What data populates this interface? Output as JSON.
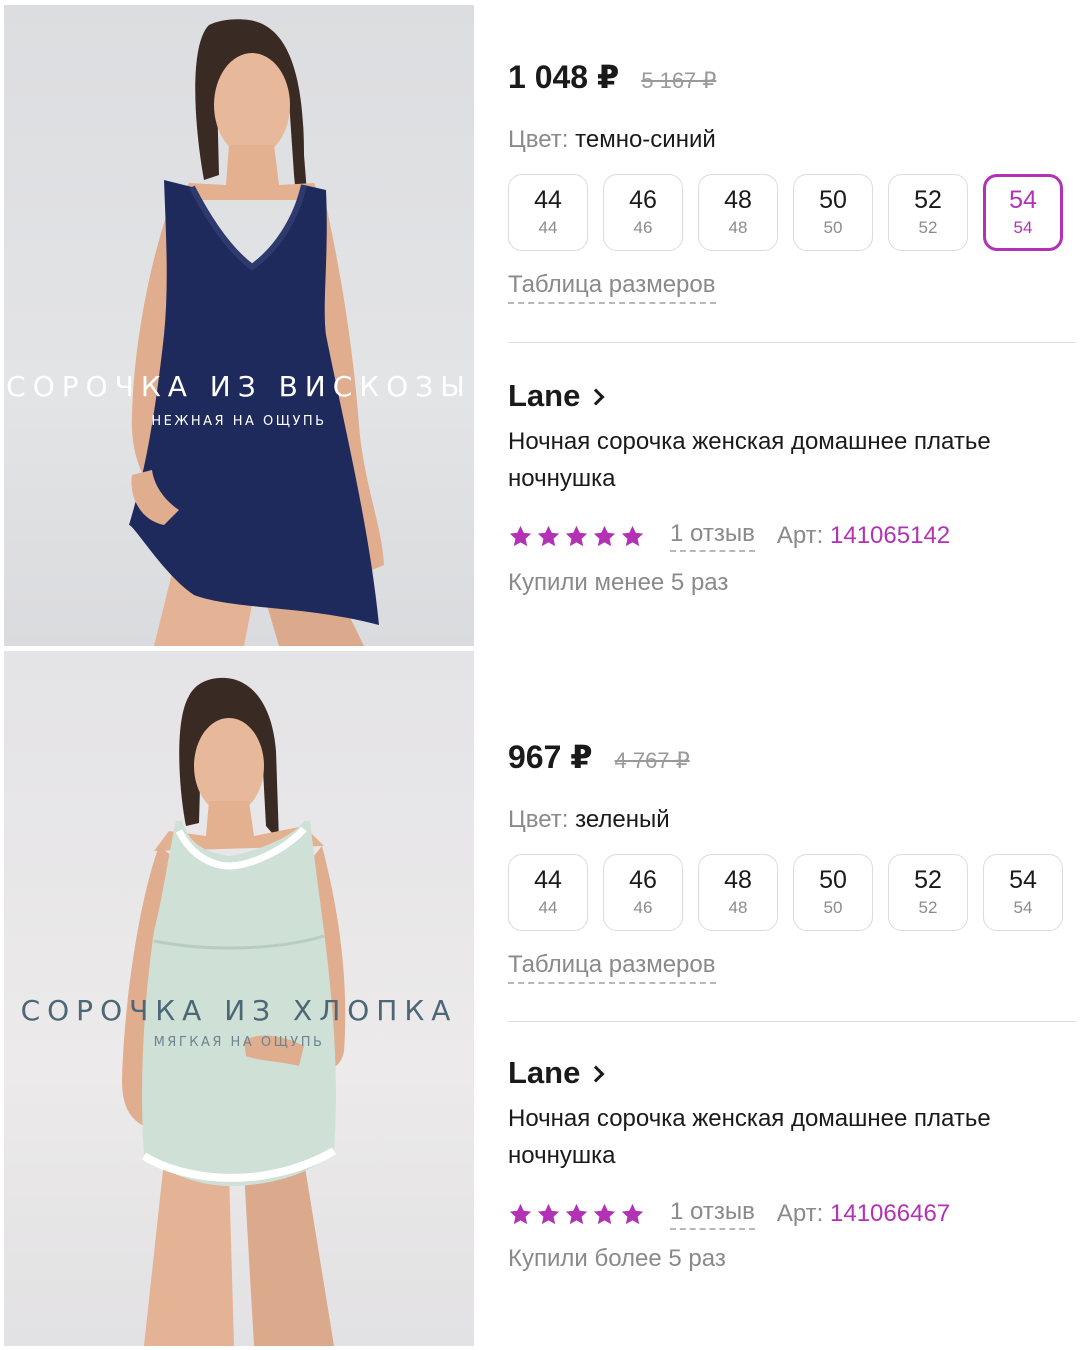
{
  "products": [
    {
      "image": {
        "overlay_title": "СОРОЧКА ИЗ ВИСКОЗЫ",
        "overlay_subtitle": "НЕЖНАЯ НА ОЩУПЬ",
        "garment_color": "#1f2a5c"
      },
      "price": "1 048 ₽",
      "old_price": "5 167 ₽",
      "color_label": "Цвет:",
      "color_value": "темно-синий",
      "sizes": [
        {
          "main": "44",
          "sub": "44",
          "selected": false
        },
        {
          "main": "46",
          "sub": "46",
          "selected": false
        },
        {
          "main": "48",
          "sub": "48",
          "selected": false
        },
        {
          "main": "50",
          "sub": "50",
          "selected": false
        },
        {
          "main": "52",
          "sub": "52",
          "selected": false
        },
        {
          "main": "54",
          "sub": "54",
          "selected": true
        }
      ],
      "size_table_link": "Таблица размеров",
      "brand": "Lane",
      "title": "Ночная сорочка женская домашнее платье ночнушка",
      "rating_stars": 5,
      "reviews": "1 отзыв",
      "art_label": "Арт:",
      "art_number": "141065142",
      "bought": "Купили менее 5 раз"
    },
    {
      "image": {
        "overlay_title": "СОРОЧКА ИЗ ХЛОПКА",
        "overlay_subtitle": "МЯГКАЯ НА ОЩУПЬ",
        "garment_color": "#cfe0d6"
      },
      "price": "967 ₽",
      "old_price": "4 767 ₽",
      "color_label": "Цвет:",
      "color_value": "зеленый",
      "sizes": [
        {
          "main": "44",
          "sub": "44",
          "selected": false
        },
        {
          "main": "46",
          "sub": "46",
          "selected": false
        },
        {
          "main": "48",
          "sub": "48",
          "selected": false
        },
        {
          "main": "50",
          "sub": "50",
          "selected": false
        },
        {
          "main": "52",
          "sub": "52",
          "selected": false
        },
        {
          "main": "54",
          "sub": "54",
          "selected": false
        }
      ],
      "size_table_link": "Таблица размеров",
      "brand": "Lane",
      "title": "Ночная сорочка женская домашнее платье ночнушка",
      "rating_stars": 5,
      "reviews": "1 отзыв",
      "art_label": "Арт:",
      "art_number": "141066467",
      "bought": "Купили более 5 раз"
    }
  ],
  "colors": {
    "accent": "#b231b5",
    "muted_text": "#8a8a8a",
    "primary_text": "#1a1a1a",
    "border": "#dcdcdc"
  }
}
